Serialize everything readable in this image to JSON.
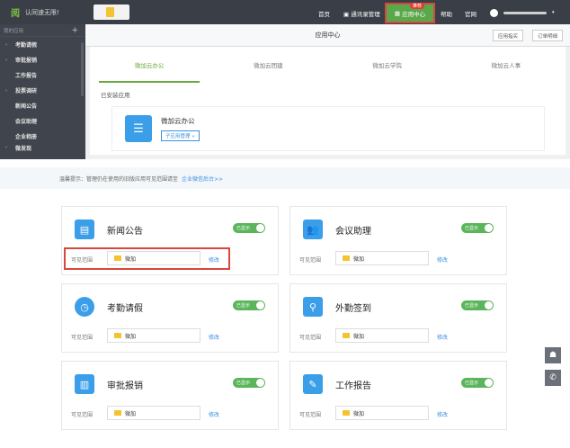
{
  "topbar": {
    "logo_text": "阅",
    "logo_name": "认同速无限!",
    "nav": {
      "home": "首页",
      "contacts": "通讯录管理",
      "app_center": "应用中心",
      "app_badge": "推荐",
      "help": "帮助",
      "site": "官网"
    }
  },
  "sidebar": {
    "header": "我的应用",
    "items": [
      {
        "label": "考勤请假",
        "arrow": "›"
      },
      {
        "label": "审批报销",
        "arrow": "›"
      },
      {
        "label": "工作报告",
        "arrow": ""
      },
      {
        "label": "投票调研",
        "arrow": "›"
      },
      {
        "label": "新闻公告",
        "arrow": ""
      },
      {
        "label": "会议助理",
        "arrow": ""
      },
      {
        "label": "企业相册",
        "arrow": ""
      },
      {
        "label": "微发现",
        "arrow": "›"
      }
    ]
  },
  "main": {
    "title": "应用中心",
    "btn_guide": "应用指买",
    "btn_orders": "订单明细",
    "tabs": [
      "微加云办公",
      "微加云团建",
      "微加云学院",
      "微加云人事"
    ],
    "installed_label": "已安装应用",
    "installed_app": {
      "name": "微加云办公",
      "button": "子应用管理 »"
    }
  },
  "notice": {
    "text": "温馨提示：管理仍在使用的旧版应用可见范围请至",
    "link": "企业微信后台>>"
  },
  "cards": [
    {
      "title": "新闻公告",
      "toggle": "已显示",
      "range_label": "可见范围",
      "range_value": "微加",
      "edit": "修改",
      "icon": "news-icon",
      "color": "#3b9ee8"
    },
    {
      "title": "会议助理",
      "toggle": "已显示",
      "range_label": "可见范围",
      "range_value": "微加",
      "edit": "修改",
      "icon": "meeting-icon",
      "color": "#3b9ee8"
    },
    {
      "title": "考勤请假",
      "toggle": "已显示",
      "range_label": "可见范围",
      "range_value": "微加",
      "edit": "修改",
      "icon": "clock-icon",
      "color": "#3b9ee8"
    },
    {
      "title": "外勤签到",
      "toggle": "已显示",
      "range_label": "可见范围",
      "range_value": "微加",
      "edit": "修改",
      "icon": "location-icon",
      "color": "#3b9ee8"
    },
    {
      "title": "审批报销",
      "toggle": "已显示",
      "range_label": "可见范围",
      "range_value": "微加",
      "edit": "修改",
      "icon": "approval-icon",
      "color": "#3b9ee8"
    },
    {
      "title": "工作报告",
      "toggle": "已显示",
      "range_label": "可见范围",
      "range_value": "微加",
      "edit": "修改",
      "icon": "report-icon",
      "color": "#3b9ee8"
    }
  ],
  "accent": "#6aaa3c"
}
